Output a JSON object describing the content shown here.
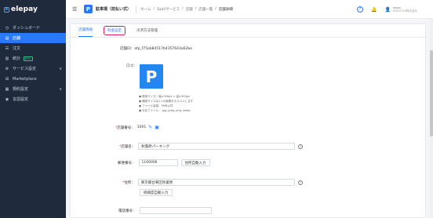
{
  "sidebar": {
    "brand": "elepay",
    "brand_mark": "e",
    "items": [
      {
        "label": "ダッシュボード",
        "icon": "dashboard-icon",
        "glyph": "◷"
      },
      {
        "label": "店舗",
        "icon": "store-icon",
        "glyph": "▤",
        "active": true
      },
      {
        "label": "注文",
        "icon": "order-icon",
        "glyph": "☰"
      },
      {
        "label": "統計",
        "icon": "stats-icon",
        "glyph": "▥",
        "badge": "BETA"
      },
      {
        "label": "サービス設定",
        "icon": "service-settings-icon",
        "glyph": "⚙",
        "caret": "∨"
      },
      {
        "label": "Marketplace",
        "icon": "marketplace-icon",
        "glyph": "⊞"
      },
      {
        "label": "規約設定",
        "icon": "terms-icon",
        "glyph": "▦",
        "caret": "∨"
      },
      {
        "label": "言語設定",
        "icon": "language-icon",
        "glyph": "◉"
      }
    ]
  },
  "header": {
    "menu_glyph": "☰",
    "app_badge": "P",
    "app_name": "駐車場（前払い式）",
    "breadcrumb": [
      "ホーム",
      "SaaSサービス",
      "店舗",
      "店舗一覧",
      "店舗詳細"
    ],
    "sep": "/",
    "help_glyph": "?",
    "bell_glyph": "🔔",
    "user_org": "ELESTYLE株式会社",
    "user_glyph": "👤"
  },
  "tabs": [
    {
      "label": "店舗情報",
      "active": true
    },
    {
      "label": "料金設定",
      "highlight": true
    },
    {
      "label": "決済方法管理"
    }
  ],
  "form": {
    "store_id_label": "店舗ID：",
    "store_id_value": "afp_f75ab84517b4357643a62be",
    "logo_label": "ロゴ：",
    "logo_glyph": "P",
    "logo_notes": [
      "● 推奨サイズ：幅≥300px × 高≥300px",
      "● 横縦サイズは1:1の画像をオススメします",
      "● ファイル容量：5MB以内",
      "● 対応ファイル：.jpg,.jpeg,.png,.webp"
    ],
    "store_no_label": "店舗番号：",
    "store_no_value": "1001",
    "store_name_label": "店舗名：",
    "store_name_value": "秋葉原パーキング",
    "zip_label": "郵便番号：",
    "zip_value": "1100006",
    "zip_button": "住所自動入力",
    "address_label": "住所：",
    "address_value": "東京都台東区秋葉原",
    "latlng_button": "経緯度自動入力",
    "phone_label": "電話番号：",
    "required_mark": "*",
    "help_glyph": "?",
    "edit_glyph": "✎",
    "qr_glyph": "▣"
  },
  "colors": {
    "accent": "#2979ff",
    "sidebar": "#1f2a3c",
    "highlight": "#d81b60"
  }
}
